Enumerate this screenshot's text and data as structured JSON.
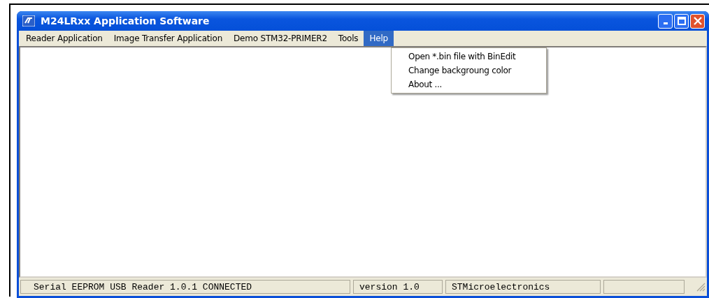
{
  "window": {
    "title": "M24LRxx Application Software"
  },
  "menu_bar": [
    {
      "label": "Reader Application",
      "selected": false
    },
    {
      "label": "Image Transfer Application",
      "selected": false
    },
    {
      "label": "Demo STM32-PRIMER2",
      "selected": false
    },
    {
      "label": "Tools",
      "selected": false
    },
    {
      "label": "Help",
      "selected": true
    }
  ],
  "help_menu": [
    "Open *.bin file with BinEdit",
    "Change backgroung color",
    "About ..."
  ],
  "status_bar": [
    "Serial EEPROM USB Reader 1.0.1 CONNECTED",
    "version 1.0",
    "STMicroelectronics"
  ]
}
